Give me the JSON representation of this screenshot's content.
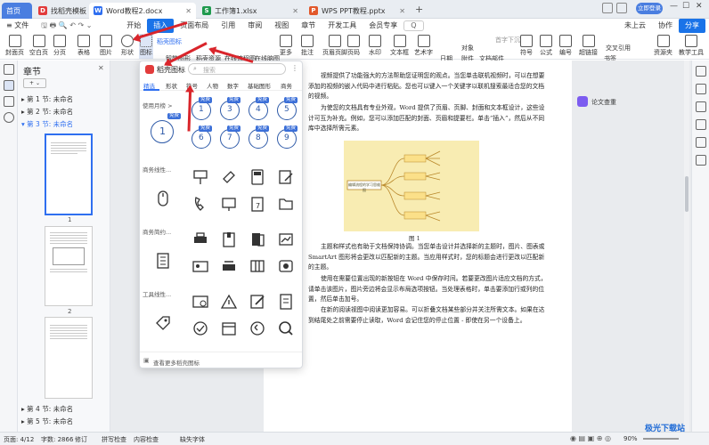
{
  "tabs": [
    {
      "label": "首页",
      "active": false
    },
    {
      "label": "找稻壳模板",
      "active": false
    },
    {
      "label": "Word教程2.docx",
      "active": true
    },
    {
      "label": "工作簿1.xlsx",
      "active": false
    },
    {
      "label": "WPS PPT教程.pptx",
      "active": false
    }
  ],
  "login_btn": "立即登录",
  "menus": [
    "≡ 文件",
    "开始",
    "插入",
    "页面布局",
    "引用",
    "审阅",
    "视图",
    "章节",
    "开发工具",
    "会员专享"
  ],
  "menu_search": "Q",
  "menu_right": {
    "cloud": "未上云",
    "collab": "协作",
    "share": "分享"
  },
  "toolbar": {
    "items": [
      "封面页",
      "空白页",
      "分页",
      "表格",
      "图片",
      "形状",
      "图标",
      "智能图形",
      "稻壳资源",
      "在线流程图",
      "在线脑图",
      "更多",
      "批注",
      "页眉页脚",
      "页码",
      "水印",
      "文本框",
      "艺术字",
      "日期",
      "附件",
      "对象",
      "文档部件",
      "符号",
      "公式",
      "编号",
      "超链接",
      "书签",
      "交叉引用",
      "资源夹",
      "教学工具"
    ],
    "extra": [
      "稻壳图标",
      "首字下沉"
    ]
  },
  "chapter_panel": {
    "title": "章节",
    "items": [
      "第 1 节: 未命名",
      "第 2 节: 未命名",
      "第 3 节: 未命名",
      "第 4 节: 未命名",
      "第 5 节: 未命名"
    ],
    "page_nums": [
      "1",
      "2"
    ]
  },
  "popup": {
    "title": "稻壳图标",
    "search_placeholder": "搜索",
    "tabs": [
      "精选",
      "形状",
      "符号",
      "人物",
      "数字",
      "基础图形",
      "商务"
    ],
    "categories": [
      "使用月榜 >",
      "商务线性...",
      "商务简约...",
      "工具线性..."
    ],
    "free_badge": "免费",
    "footer": "查看更多稻壳图标"
  },
  "document": {
    "paragraphs": [
      "视频提供了功能强大的方法帮助您证明您的观点。当您单击联机视频时，可以在想要添加的视频的嵌入代码中进行粘贴。您也可以键入一个关键字以联机搜索最适合您的文档的视频。",
      "为使您的文档具有专业外观，Word 提供了页眉、页脚、封面和文本框设计，这些设计可互为补充。例如，您可以添加匹配的封面、页眉和提要栏。单击“插入”，然后从不同库中选择所需元素。",
      "图 1",
      "主题和样式也有助于文档保持协调。当您单击设计并选择新的主题时，图片、图表或 SmartArt 图形将会更改以匹配新的主题。当应用样式时，您的标题会进行更改以匹配新的主题。",
      "使用在需要位置出现的新按钮在 Word 中保存时间。若要更改图片适应文档的方式，请单击该图片，图片旁边将会显示布局选项按钮。当处理表格时，单击要添加行或列的位置，然后单击加号。",
      "在新的阅读视图中阅读更加容易。可以折叠文档某些部分并关注所需文本。如果在达到结尾处之前需要停止读取，Word 会记住您的停止位置 - 即使在另一个设备上。"
    ],
    "diagram_label": "编辑流程的学习思维图"
  },
  "side_tools": {
    "review": "论文查重"
  },
  "status": {
    "page": "页面: 4/12",
    "words": "字数: 2866",
    "revise": "修订",
    "spell": "拼写检查",
    "content": "内容检查",
    "missing_font": "缺失字体",
    "zoom": "90%"
  },
  "watermark": "极光下载站",
  "colors": {
    "accent": "#1a73e8",
    "arrow": "#d9252b",
    "icon_blue": "#2e5aa8",
    "yellow_figure": "#f8ecb2"
  }
}
